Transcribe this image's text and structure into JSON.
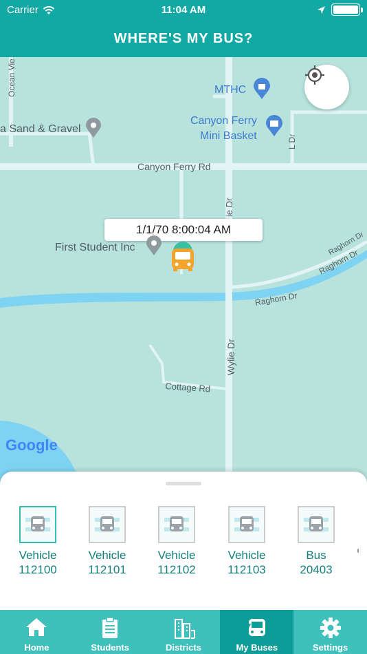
{
  "status_bar": {
    "carrier": "Carrier",
    "time": "11:04 AM"
  },
  "header": {
    "title": "WHERE'S MY BUS?"
  },
  "map": {
    "labels": {
      "ocean_view": "Ocean Vie",
      "sand_gravel": "a Sand & Gravel",
      "mthc": "MTHC",
      "canyon_ferry_mini_1": "Canyon Ferry",
      "canyon_ferry_mini_2": "Mini Basket",
      "l_dr": "L Dr",
      "canyon_ferry_rd": "Canyon Ferry Rd",
      "wylie_dr_top": "ie Dr",
      "first_student": "First Student Inc",
      "raghorn_dr_1": "Raghorn Dr",
      "raghorn_dr_2": "Raghorn Dr",
      "raghorn_dr_3": "Raghorn Dr",
      "wylie_dr": "Wylie Dr",
      "cottage_rd": "Cottage Rd"
    },
    "bus_timestamp": "1/1/70 8:00:04 AM",
    "google_logo": "Google",
    "colors": {
      "water": "#7fd3f2",
      "road": "#e2f4f4",
      "land": "#b8e2dc"
    }
  },
  "buses": [
    {
      "line1": "Vehicle",
      "line2": "112100",
      "selected": true
    },
    {
      "line1": "Vehicle",
      "line2": "112101",
      "selected": false
    },
    {
      "line1": "Vehicle",
      "line2": "112102",
      "selected": false
    },
    {
      "line1": "Vehicle",
      "line2": "112103",
      "selected": false
    },
    {
      "line1": "Bus",
      "line2": "20403",
      "selected": false
    }
  ],
  "tabs": [
    {
      "label": "Home",
      "icon": "home-icon"
    },
    {
      "label": "Students",
      "icon": "clipboard-icon"
    },
    {
      "label": "Districts",
      "icon": "buildings-icon"
    },
    {
      "label": "My Buses",
      "icon": "bus-icon",
      "active": true
    },
    {
      "label": "Settings",
      "icon": "gear-icon"
    }
  ]
}
